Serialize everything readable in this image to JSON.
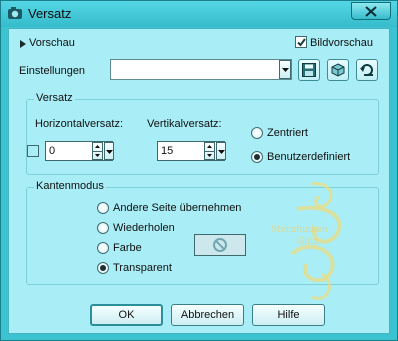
{
  "window": {
    "title": "Versatz",
    "close_label": "Close"
  },
  "header": {
    "preview_toggle_label": "Vorschau",
    "image_preview_label": "Bildvorschau",
    "image_preview_checked": true
  },
  "settings": {
    "label": "Einstellungen",
    "value": ""
  },
  "versatz": {
    "group_label": "Versatz",
    "horizontal_label": "Horizontalversatz:",
    "horizontal_value": "0",
    "vertical_label": "Vertikalversatz:",
    "vertical_value": "15",
    "options": [
      {
        "label": "Zentriert",
        "selected": false
      },
      {
        "label": "Benutzerdefiniert",
        "selected": true
      }
    ]
  },
  "edge_mode": {
    "group_label": "Kantenmodus",
    "options": [
      {
        "label": "Andere Seite übernehmen",
        "selected": false
      },
      {
        "label": "Wiederholen",
        "selected": false
      },
      {
        "label": "Farbe",
        "selected": false
      },
      {
        "label": "Transparent",
        "selected": true
      }
    ]
  },
  "buttons": {
    "ok": "OK",
    "cancel": "Abbrechen",
    "help": "Hilfe"
  },
  "watermark": {
    "line1": "Sternfunken",
    "line2": "Glitz"
  },
  "colors": {
    "titlebar": "#3cc3d2",
    "client": "#a9eef6",
    "accent": "#1a7e8b"
  }
}
